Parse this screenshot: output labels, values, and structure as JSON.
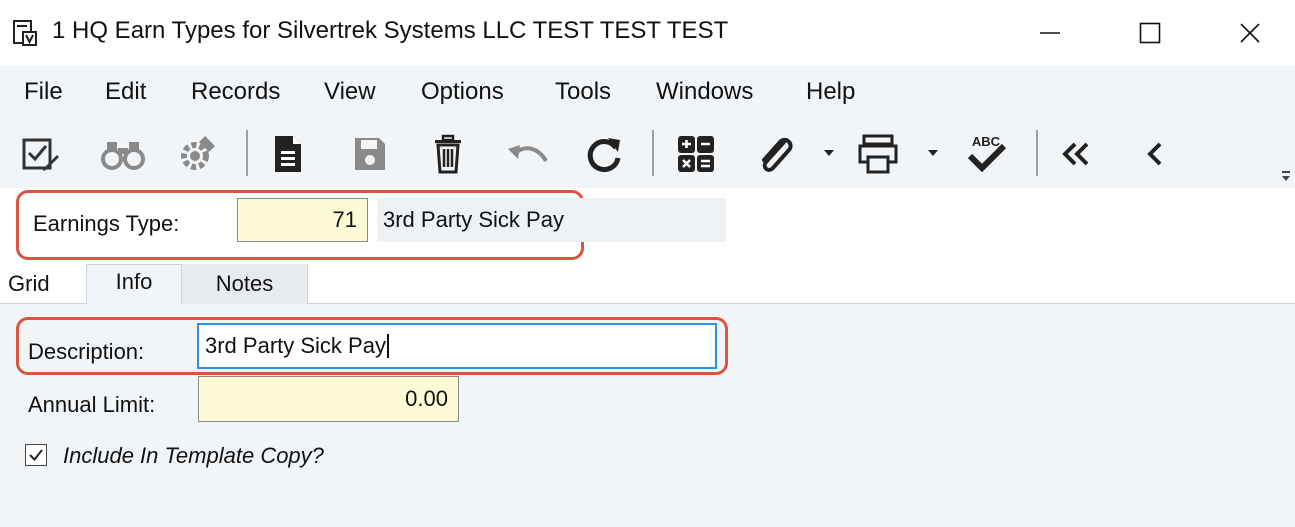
{
  "window": {
    "title": "1 HQ Earn Types for Silvertrek Systems LLC TEST TEST TEST",
    "app_icon": "report-icon",
    "controls": [
      "minimize-icon",
      "maximize-icon",
      "close-icon"
    ]
  },
  "menu": {
    "items": [
      "File",
      "Edit",
      "Records",
      "View",
      "Options",
      "Tools",
      "Windows",
      "Help"
    ]
  },
  "toolbar": {
    "icons": [
      "checklist-edit-icon",
      "binoculars-icon",
      "settings-gear-icon",
      "new-document-icon",
      "save-icon",
      "delete-icon",
      "undo-icon",
      "refresh-icon",
      "calculator-icon",
      "attachment-icon",
      "print-icon",
      "spellcheck-icon",
      "first-record-icon",
      "previous-record-icon"
    ],
    "spellcheck_text": "ABC"
  },
  "header": {
    "earnings_type_label": "Earnings Type:",
    "earnings_type_value": "71",
    "earnings_type_description": "3rd Party Sick Pay"
  },
  "tabs": [
    "Grid",
    "Info",
    "Notes"
  ],
  "active_tab": "Info",
  "form": {
    "description_label": "Description:",
    "description_value": "3rd Party Sick Pay",
    "annual_limit_label": "Annual Limit:",
    "annual_limit_value": "0.00",
    "include_template_label": "Include In Template Copy?",
    "include_template_checked": true
  },
  "colors": {
    "callout": "#d9553e",
    "required_field": "#fcfbd5",
    "focus_border": "#2f8fe0",
    "panel_background": "#f2f5f8"
  }
}
